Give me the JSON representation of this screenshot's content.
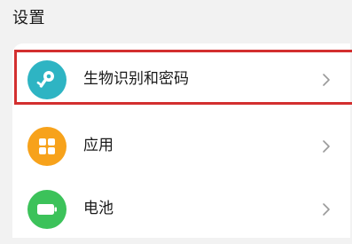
{
  "header": {
    "title": "设置"
  },
  "settings": {
    "items": [
      {
        "label": "生物识别和密码",
        "icon": "key-icon",
        "color": "#2eb4c3",
        "highlighted": true
      },
      {
        "label": "应用",
        "icon": "apps-grid-icon",
        "color": "#f7a21b",
        "highlighted": false
      },
      {
        "label": "电池",
        "icon": "battery-icon",
        "color": "#3cc25a",
        "highlighted": false
      }
    ]
  },
  "colors": {
    "highlight_border": "#d32f2f",
    "background": "#f2f2f2",
    "card": "#ffffff"
  }
}
